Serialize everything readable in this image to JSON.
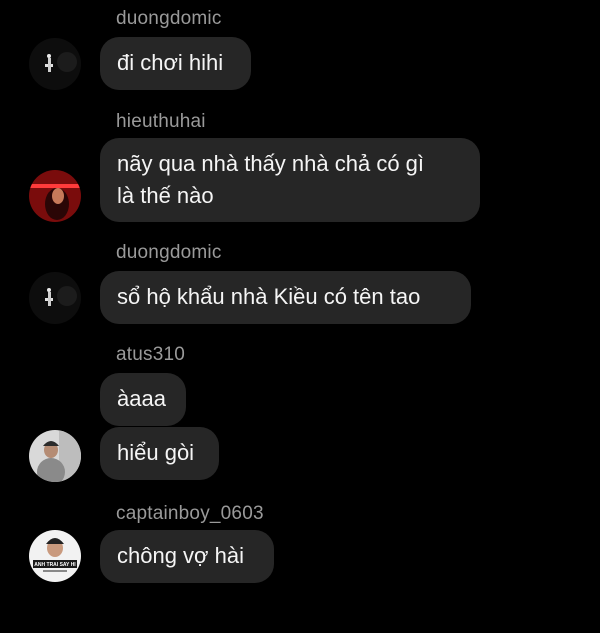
{
  "messages": [
    {
      "username": "duongdomic",
      "text": "đi chơi hihi",
      "avatar": "duongdomic-avatar"
    },
    {
      "username": "hieuthuhai",
      "text_lines": [
        "nãy qua nhà thấy nhà chả có gì",
        "là thế nào"
      ],
      "avatar": "hieuthuhai-avatar"
    },
    {
      "username": "duongdomic",
      "text": "sổ hộ khẩu nhà Kiều có tên tao",
      "avatar": "duongdomic-avatar"
    },
    {
      "username": "atus310",
      "texts": [
        "àaaa",
        "hiểu gòi"
      ],
      "avatar": "atus310-avatar"
    },
    {
      "username": "captainboy_0603",
      "text": "chông vợ hài",
      "avatar": "captainboy-avatar",
      "avatar_caption": "ANH TRAI SAY HI"
    }
  ],
  "colors": {
    "background": "#000000",
    "bubble": "#262626",
    "username": "#9a9a9a",
    "text": "#f5f5f5"
  }
}
